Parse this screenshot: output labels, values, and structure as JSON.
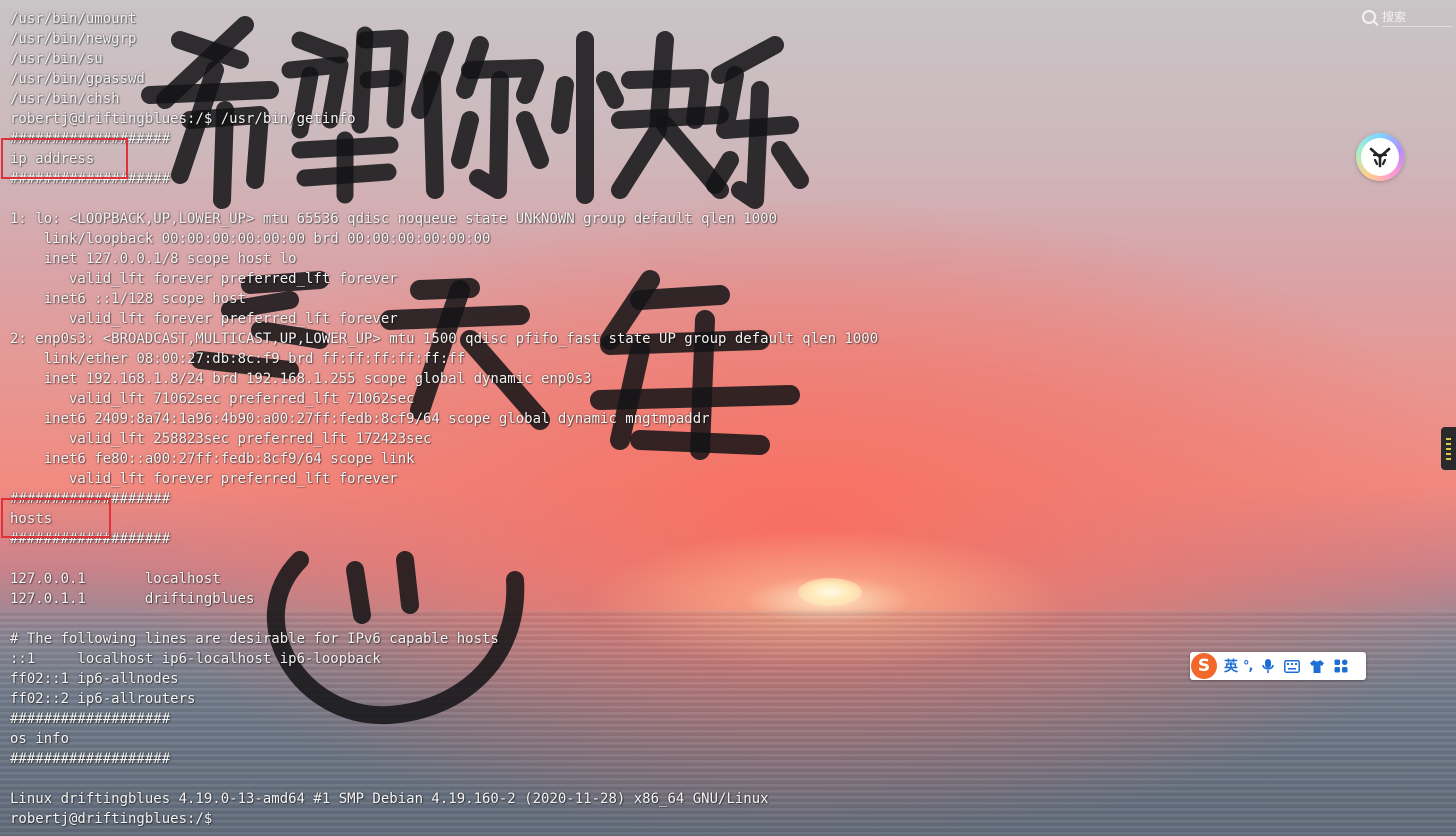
{
  "terminal": {
    "lines": [
      "/usr/bin/umount",
      "/usr/bin/newgrp",
      "/usr/bin/su",
      "/usr/bin/gpasswd",
      "/usr/bin/chsh",
      "robertj@driftingblues:/$ /usr/bin/getinfo",
      "###################",
      "ip address",
      "###################",
      "",
      "1: lo: <LOOPBACK,UP,LOWER_UP> mtu 65536 qdisc noqueue state UNKNOWN group default qlen 1000",
      "    link/loopback 00:00:00:00:00:00 brd 00:00:00:00:00:00",
      "    inet 127.0.0.1/8 scope host lo",
      "       valid_lft forever preferred_lft forever",
      "    inet6 ::1/128 scope host",
      "       valid_lft forever preferred_lft forever",
      "2: enp0s3: <BROADCAST,MULTICAST,UP,LOWER_UP> mtu 1500 qdisc pfifo_fast state UP group default qlen 1000",
      "    link/ether 08:00:27:db:8c:f9 brd ff:ff:ff:ff:ff:ff",
      "    inet 192.168.1.8/24 brd 192.168.1.255 scope global dynamic enp0s3",
      "       valid_lft 71062sec preferred_lft 71062sec",
      "    inet6 2409:8a74:1a96:4b90:a00:27ff:fedb:8cf9/64 scope global dynamic mngtmpaddr",
      "       valid_lft 258823sec preferred_lft 172423sec",
      "    inet6 fe80::a00:27ff:fedb:8cf9/64 scope link",
      "       valid_lft forever preferred_lft forever",
      "###################",
      "hosts",
      "###################",
      "",
      "127.0.0.1       localhost",
      "127.0.1.1       driftingblues",
      "",
      "# The following lines are desirable for IPv6 capable hosts",
      "::1     localhost ip6-localhost ip6-loopback",
      "ff02::1 ip6-allnodes",
      "ff02::2 ip6-allrouters",
      "###################",
      "os info",
      "###################",
      "",
      "Linux driftingblues 4.19.0-13-amd64 #1 SMP Debian 4.19.160-2 (2020-11-28) x86_64 GNU/Linux",
      "robertj@driftingblues:/$"
    ]
  },
  "highlights": [
    "ip address",
    "hosts"
  ],
  "search": {
    "placeholder": "搜索"
  },
  "wallpaper": {
    "calligraphy_text": "希望你快乐 每天"
  },
  "ime_toolbar": {
    "logo": "S",
    "language": "英",
    "punctuation": "°,",
    "icons": [
      "microphone-icon",
      "keyboard-icon",
      "shirt-icon",
      "apps-grid-icon"
    ],
    "accent_color": "#1d6fd6",
    "logo_color": "#f2682b"
  },
  "assistant": {
    "icon": "assistant-icon"
  },
  "colors": {
    "highlight_box": "#e0303a",
    "terminal_text": "#f4f4f4"
  }
}
